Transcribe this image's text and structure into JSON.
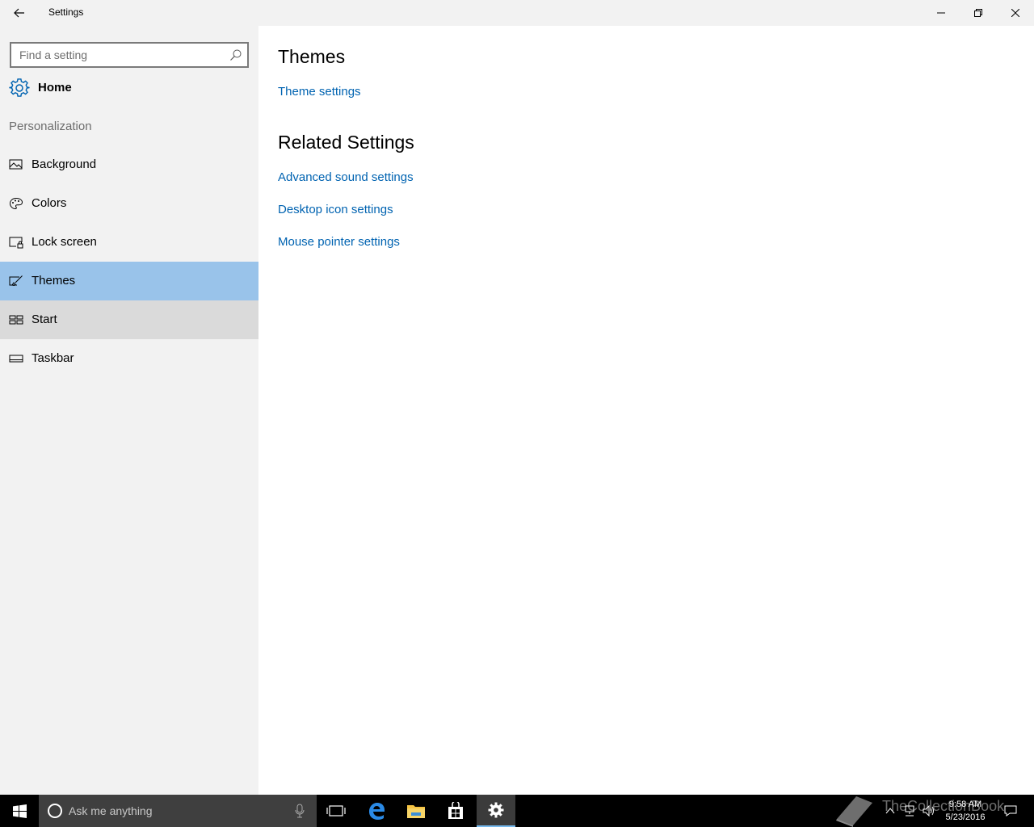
{
  "window": {
    "title": "Settings",
    "back_icon": "back-arrow-icon",
    "controls": [
      "minimize-icon",
      "maximize-icon",
      "close-icon"
    ]
  },
  "sidebar": {
    "search": {
      "placeholder": "Find a setting",
      "value": ""
    },
    "home_label": "Home",
    "section_title": "Personalization",
    "items": [
      {
        "label": "Background",
        "icon": "picture-icon",
        "state": "normal"
      },
      {
        "label": "Colors",
        "icon": "palette-icon",
        "state": "normal"
      },
      {
        "label": "Lock screen",
        "icon": "lock-screen-icon",
        "state": "normal"
      },
      {
        "label": "Themes",
        "icon": "themes-brush-icon",
        "state": "selected"
      },
      {
        "label": "Start",
        "icon": "start-tiles-icon",
        "state": "hover"
      },
      {
        "label": "Taskbar",
        "icon": "taskbar-icon",
        "state": "normal"
      }
    ]
  },
  "main": {
    "themes_heading": "Themes",
    "theme_settings_link": "Theme settings",
    "related_heading": "Related Settings",
    "related_links": [
      "Advanced sound settings",
      "Desktop icon settings",
      "Mouse pointer settings"
    ]
  },
  "taskbar": {
    "search_placeholder": "Ask me anything",
    "apps": [
      "task-view-icon",
      "edge-icon",
      "file-explorer-icon",
      "store-icon",
      "settings-icon"
    ],
    "active_app": "settings-icon",
    "time": "9:58 AM",
    "date": "5/23/2016",
    "watermark": "TheCollectionBook"
  },
  "colors": {
    "accent": "#0063b1",
    "selected_bg": "#99c3ea",
    "hover_bg": "#dadada",
    "sidebar_bg": "#f2f2f2",
    "taskbar_bg": "#000000"
  }
}
